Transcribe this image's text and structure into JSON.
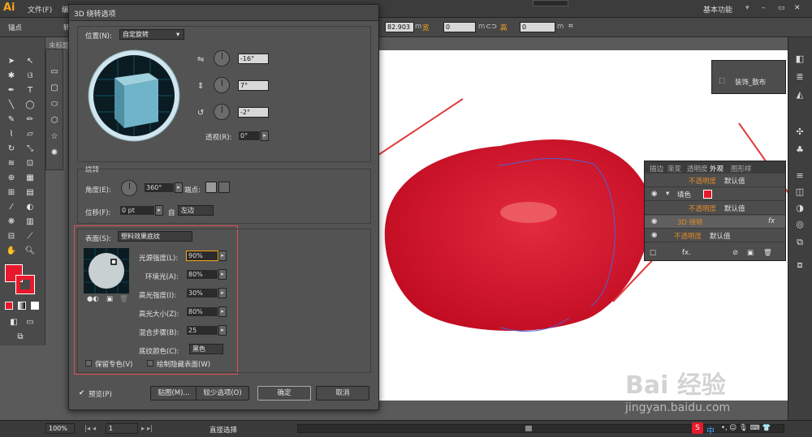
{
  "app": {
    "logo": "Ai",
    "menu_file": "文件(F)",
    "menu_edit": "编",
    "workspace": "基本功能"
  },
  "control_bar": {
    "label_anchor": "锚点",
    "label_convert": "转",
    "x_value": "82.903",
    "x_unit": "m",
    "w_label": "宽",
    "w_value": "0",
    "w_unit": "m",
    "h_label": "高",
    "h_value": "0",
    "h_unit": "m",
    "y_value": "0"
  },
  "tab": {
    "label": "未标题"
  },
  "dialog": {
    "title": "3D 绕转选项",
    "position_label": "位置(N):",
    "position_value": "自定旋转",
    "rot_x": "-16°",
    "rot_y": "7°",
    "rot_z": "-2°",
    "perspective_label": "透视(R):",
    "perspective_value": "0°",
    "revolve_section": "绕转",
    "angle_label": "角度(E):",
    "angle_value": "360°",
    "cap_label": "端点:",
    "offset_label": "位移(F):",
    "offset_value": "0 pt",
    "from_label": "自",
    "from_value": "左边",
    "surface_label": "表面(S):",
    "surface_value": "塑料效果底纹",
    "light_intensity_label": "光源强度(L):",
    "light_intensity_value": "90%",
    "ambient_label": "环境光(A):",
    "ambient_value": "80%",
    "highlight_intensity_label": "高光强度(I):",
    "highlight_intensity_value": "30%",
    "highlight_size_label": "高光大小(Z):",
    "highlight_size_value": "80%",
    "blend_steps_label": "混合步骤(B):",
    "blend_steps_value": "25",
    "shade_color_label": "底纹颜色(C):",
    "shade_color_value": "黑色",
    "preserve_spot_label": "保留专色(V)",
    "draw_hidden_label": "绘制隐藏表面(W)",
    "preview_label": "预览(P)",
    "map_button": "贴图(M)...",
    "fewer_options_button": "较少选项(O)",
    "ok_button": "确定",
    "cancel_button": "取消"
  },
  "brush_panel": {
    "label": "装饰_散布"
  },
  "appearance_panel": {
    "tabs": [
      "描边",
      "渐变",
      "透明度",
      "外观",
      "图形样"
    ],
    "rows": [
      {
        "name": "不透明度",
        "value": "默认值"
      },
      {
        "name": "填色",
        "value": ""
      },
      {
        "name": "不透明度",
        "value": "默认值"
      },
      {
        "name": "3D 绕转",
        "value": "fx"
      },
      {
        "name": "不透明度",
        "value": "默认值"
      }
    ],
    "footer_fx": "fx."
  },
  "status": {
    "zoom": "100%",
    "page": "1",
    "tool": "直接选择"
  },
  "watermark": {
    "brand": "Bai 经验",
    "url": "jingyan.baidu.com"
  },
  "ime": {
    "label": "中"
  },
  "colors": {
    "fill": "#e8192c",
    "apple": "#d1122a",
    "accent_orange": "#f7a51c"
  }
}
